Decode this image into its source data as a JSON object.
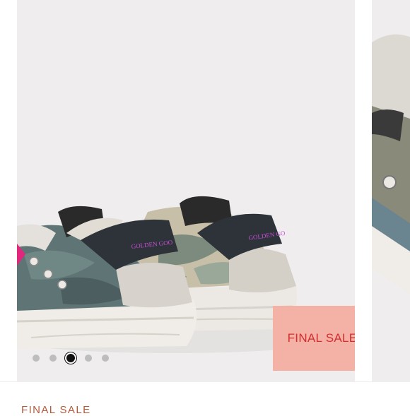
{
  "listing": {
    "badge_label": "FINAL SALE",
    "section_heading": "FINAL SALE",
    "shoe_brand_print": "GOLDEN GOOSE"
  },
  "carousel": {
    "slide_count": 5,
    "active_index": 2,
    "dots": [
      "slide-1",
      "slide-2",
      "slide-3",
      "slide-4",
      "slide-5"
    ]
  },
  "colors": {
    "badge_background": "#f4b1a6",
    "badge_text": "#d42e2e",
    "heading_text": "#b35b3a",
    "photo_background": "#efedee",
    "active_dot": "#111111",
    "inactive_dot": "#bdbdbd"
  }
}
